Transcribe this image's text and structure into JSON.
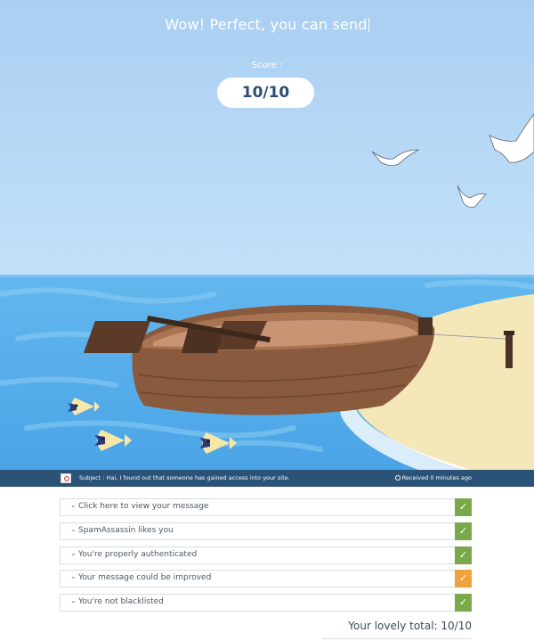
{
  "header": {
    "headline": "Wow! Perfect, you can send",
    "score_label": "Score :",
    "score_value": "10/10"
  },
  "message_bar": {
    "subject": "Subject : Hai, I found out that someone has gained access into your site.",
    "received": "Received 0 minutes ago"
  },
  "checks": [
    {
      "label": "Click here to view your message",
      "status": "pass",
      "icon": "check-icon"
    },
    {
      "label": "SpamAssassin likes you",
      "status": "pass",
      "icon": "check-icon"
    },
    {
      "label": "You're properly authenticated",
      "status": "pass",
      "icon": "check-icon"
    },
    {
      "label": "Your message could be improved",
      "status": "warning",
      "icon": "check-icon"
    },
    {
      "label": "You're not blacklisted",
      "status": "pass",
      "icon": "check-icon"
    }
  ],
  "total": "Your lovely total: 10/10",
  "colors": {
    "pass": "#79a949",
    "warning": "#f0a33c",
    "bar": "#2b5277",
    "sky": "#b3d6f5",
    "sea": "#5ab0ec",
    "sand": "#f4e8b8",
    "boat": "#8a5a3e"
  },
  "icons": {
    "chevron": "chevron-down-icon",
    "mail": "mail-icon",
    "clock": "clock-icon"
  }
}
